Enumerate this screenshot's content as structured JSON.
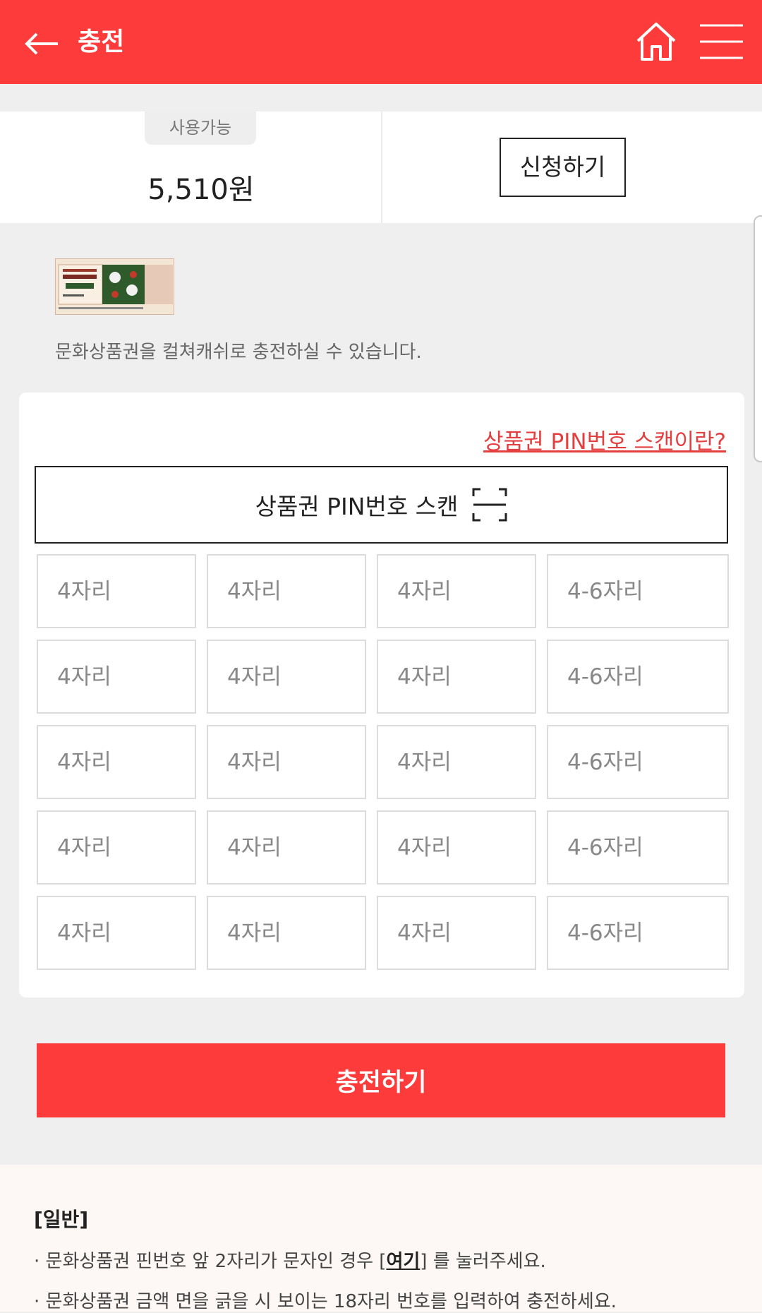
{
  "header": {
    "title": "충전"
  },
  "balance": {
    "badge": "사용가능",
    "amount": "5,510원",
    "apply_label": "신청하기"
  },
  "voucher": {
    "description": "문화상품권을 컬쳐캐쉬로 충전하실 수 있습니다."
  },
  "pin_section": {
    "help_link": "상품권 PIN번호 스캔이란?",
    "scan_label": "상품권 PIN번호 스캔",
    "short_placeholder": "4자리",
    "long_placeholder": "4-6자리",
    "rows": 5
  },
  "charge_button": "충전하기",
  "notes": {
    "title": "[일반]",
    "line1_before": "· 문화상품권 핀번호 앞 2자리가 문자인 경우 [",
    "line1_link": "여기",
    "line1_after": "] 를 눌러주세요.",
    "line2": "· 문화상품권 금액 면을 긁을 시 보이는 18자리 번호를 입력하여 충전하세요."
  },
  "colors": {
    "accent": "#fd3b3b",
    "link": "#e43f3f"
  },
  "icons": [
    "back-arrow-icon",
    "home-icon",
    "hamburger-menu-icon",
    "scan-frame-icon"
  ]
}
